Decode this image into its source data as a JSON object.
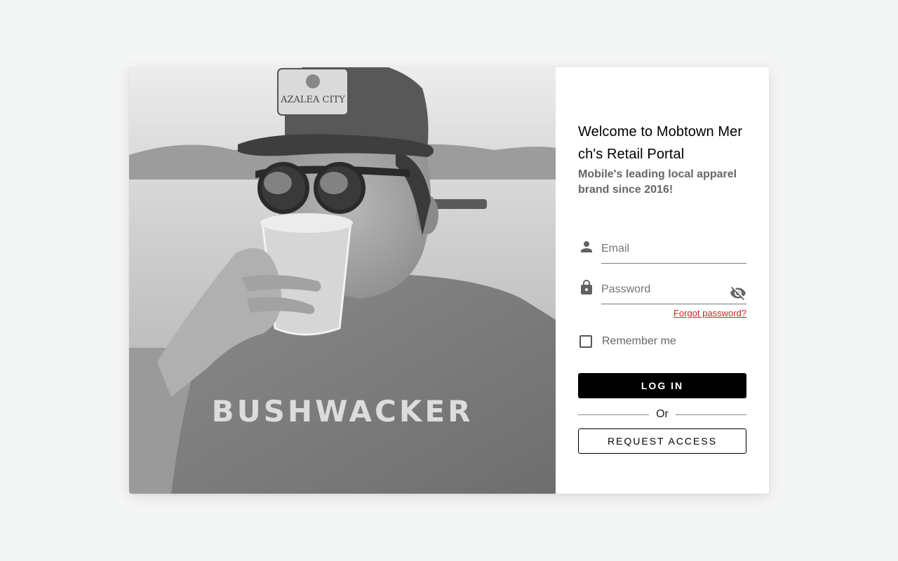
{
  "hero_image": {
    "hat_patch_text": "AZALEA CITY",
    "shirt_text": "BUSHWACKER"
  },
  "login": {
    "title": "Welcome to Mobtown Merch's Retail Portal",
    "subtitle": "Mobile's leading local apparel brand since 2016!",
    "email": {
      "placeholder": "Email",
      "value": "",
      "icon": "person-icon"
    },
    "password": {
      "placeholder": "Password",
      "value": "",
      "icon": "lock-icon",
      "toggle_icon": "visibility-off-icon"
    },
    "forgot_password_label": "Forgot password?",
    "remember_me_label": "Remember me",
    "remember_me_checked": false,
    "login_button_label": "LOG IN",
    "divider_label": "Or",
    "request_access_label": "REQUEST ACCESS"
  },
  "colors": {
    "background": "#f4f5f5",
    "primary_button": "#000000",
    "link": "#c62828",
    "subtitle": "#666666"
  }
}
